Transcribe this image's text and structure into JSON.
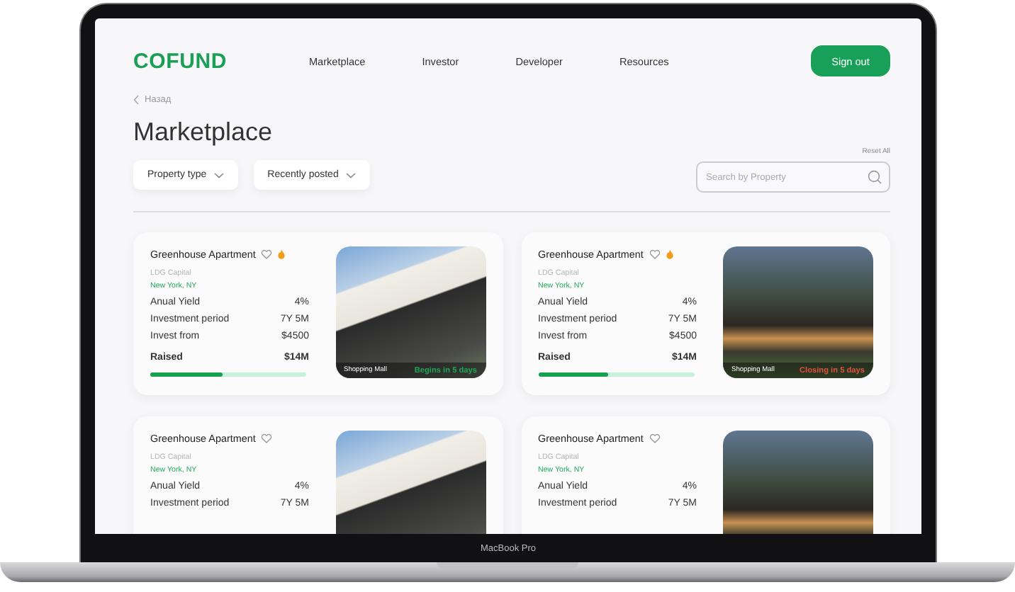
{
  "header": {
    "logo": "COFUND",
    "nav": [
      "Marketplace",
      "Investor",
      "Developer",
      "Resources"
    ],
    "sign_out": "Sign out"
  },
  "back_link": "Назад",
  "title": "Marketplace",
  "reset": "Reset All",
  "filters": [
    "Property type",
    "Recently posted"
  ],
  "search": {
    "placeholder": "Search by Property"
  },
  "cards": [
    {
      "title": "Greenhouse Apartment",
      "favorite": false,
      "hot": true,
      "company": "LDG Capital",
      "location": "New York, NY",
      "stats": [
        {
          "label": "Anual Yield",
          "value": "4%"
        },
        {
          "label": "Investment period",
          "value": "7Y 5M"
        },
        {
          "label": "Invest from",
          "value": "$4500"
        }
      ],
      "raised": {
        "label": "Raised",
        "value": "$14M",
        "level": 0.46
      },
      "photo": {
        "kind": "white-house",
        "tag": "Shopping Mall",
        "status": {
          "text": "Begins in 5 days",
          "color": "#22a559"
        }
      }
    },
    {
      "title": "Greenhouse Apartment",
      "favorite": false,
      "hot": true,
      "company": "LDG Capital",
      "location": "New York, NY",
      "stats": [
        {
          "label": "Anual Yield",
          "value": "4%"
        },
        {
          "label": "Investment period",
          "value": "7Y 5M"
        },
        {
          "label": "Invest from",
          "value": "$4500"
        }
      ],
      "raised": {
        "label": "Raised",
        "value": "$14M",
        "level": 0.45
      },
      "photo": {
        "kind": "tree-house",
        "tag": "Shopping Mall",
        "status": {
          "text": "Closing in 5 days",
          "color": "#e0553a"
        }
      }
    },
    {
      "title": "Greenhouse Apartment",
      "favorite": false,
      "hot": false,
      "company": "LDG Capital",
      "location": "New York, NY",
      "stats": [
        {
          "label": "Anual Yield",
          "value": "4%"
        },
        {
          "label": "Investment period",
          "value": "7Y 5M"
        }
      ],
      "photo": {
        "kind": "white-house"
      }
    },
    {
      "title": "Greenhouse Apartment",
      "favorite": false,
      "hot": false,
      "company": "LDG Capital",
      "location": "New York, NY",
      "stats": [
        {
          "label": "Anual Yield",
          "value": "4%"
        },
        {
          "label": "Investment period",
          "value": "7Y 5M"
        }
      ],
      "photo": {
        "kind": "tree-house"
      }
    }
  ],
  "device_label": "MacBook Pro"
}
